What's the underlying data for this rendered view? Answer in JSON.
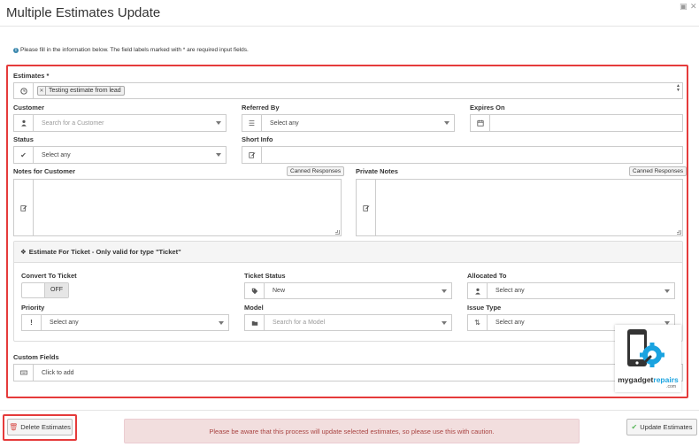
{
  "page": {
    "title": "Multiple Estimates Update",
    "info_text": "Please fill in the information below. The field labels marked with * are required input fields."
  },
  "form": {
    "estimates_label": "Estimates *",
    "estimates_tag": "Testing estimate from lead",
    "customer_label": "Customer",
    "customer_placeholder": "Search for a Customer",
    "referred_by_label": "Referred By",
    "referred_by_value": "Select any",
    "expires_on_label": "Expires On",
    "status_label": "Status",
    "status_value": "Select any",
    "short_info_label": "Short Info",
    "notes_customer_label": "Notes for Customer",
    "private_notes_label": "Private Notes",
    "canned_label": "Canned Responses",
    "custom_fields_label": "Custom Fields",
    "custom_fields_placeholder": "Click to add"
  },
  "ticket": {
    "heading": "Estimate For Ticket - Only valid for type \"Ticket\"",
    "convert_label": "Convert To Ticket",
    "convert_state": "OFF",
    "ticket_status_label": "Ticket Status",
    "ticket_status_value": "New",
    "allocated_to_label": "Allocated To",
    "allocated_to_value": "Select any",
    "priority_label": "Priority",
    "priority_value": "Select any",
    "model_label": "Model",
    "model_placeholder": "Search for a Model",
    "issue_type_label": "Issue Type",
    "issue_type_value": "Select any"
  },
  "footer": {
    "delete_label": "Delete Estimates",
    "warning_text": "Please be aware that this process will update selected estimates, so please use this with caution.",
    "update_label": "Update Estimates"
  },
  "logo": {
    "text_dark": "mygadget",
    "text_blue": "repairs",
    "suffix": ".com"
  },
  "colors": {
    "highlight_red": "#e53b3b",
    "warning_bg": "#f2dede",
    "warning_text": "#a94442",
    "success_green": "#5cb85c",
    "danger_red": "#d9534f",
    "brand_blue": "#1aa3e0"
  }
}
